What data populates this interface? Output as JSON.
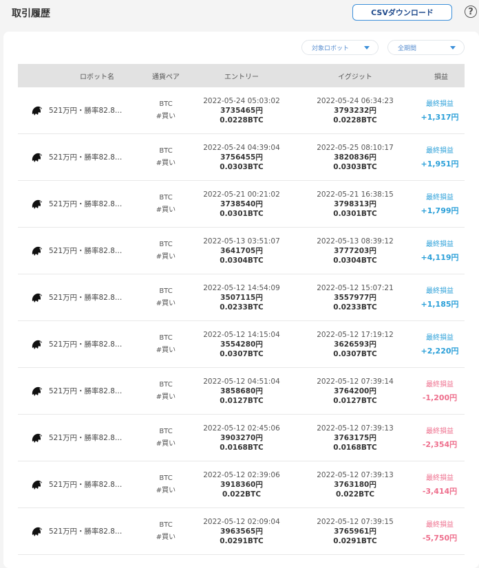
{
  "header": {
    "title": "取引履歴",
    "csv_button": "CSVダウンロード",
    "help_icon": "?"
  },
  "filters": {
    "robot": "対象ロボット",
    "period": "全期間"
  },
  "columns": {
    "robot": "ロボット名",
    "pair": "通貨ペア",
    "entry": "エントリー",
    "exit": "イグジット",
    "pnl": "損益"
  },
  "colors": {
    "profit": "#2a9fd8",
    "loss": "#ee6e8c",
    "accent": "#3b8fd9"
  },
  "rows": [
    {
      "robot": "521万円・勝率82.8…",
      "pair": "BTC",
      "side": "#買い",
      "entry_time": "2022-05-24 05:03:02",
      "entry_price": "3735465円",
      "entry_qty": "0.0228BTC",
      "exit_time": "2022-05-24 06:34:23",
      "exit_price": "3793232円",
      "exit_qty": "0.0228BTC",
      "pnl_label": "最終損益",
      "pnl": "+1,317円",
      "sign": "pos"
    },
    {
      "robot": "521万円・勝率82.8…",
      "pair": "BTC",
      "side": "#買い",
      "entry_time": "2022-05-24 04:39:04",
      "entry_price": "3756455円",
      "entry_qty": "0.0303BTC",
      "exit_time": "2022-05-25 08:10:17",
      "exit_price": "3820836円",
      "exit_qty": "0.0303BTC",
      "pnl_label": "最終損益",
      "pnl": "+1,951円",
      "sign": "pos"
    },
    {
      "robot": "521万円・勝率82.8…",
      "pair": "BTC",
      "side": "#買い",
      "entry_time": "2022-05-21 00:21:02",
      "entry_price": "3738540円",
      "entry_qty": "0.0301BTC",
      "exit_time": "2022-05-21 16:38:15",
      "exit_price": "3798313円",
      "exit_qty": "0.0301BTC",
      "pnl_label": "最終損益",
      "pnl": "+1,799円",
      "sign": "pos"
    },
    {
      "robot": "521万円・勝率82.8…",
      "pair": "BTC",
      "side": "#買い",
      "entry_time": "2022-05-13 03:51:07",
      "entry_price": "3641705円",
      "entry_qty": "0.0304BTC",
      "exit_time": "2022-05-13 08:39:12",
      "exit_price": "3777203円",
      "exit_qty": "0.0304BTC",
      "pnl_label": "最終損益",
      "pnl": "+4,119円",
      "sign": "pos"
    },
    {
      "robot": "521万円・勝率82.8…",
      "pair": "BTC",
      "side": "#買い",
      "entry_time": "2022-05-12 14:54:09",
      "entry_price": "3507115円",
      "entry_qty": "0.0233BTC",
      "exit_time": "2022-05-12 15:07:21",
      "exit_price": "3557977円",
      "exit_qty": "0.0233BTC",
      "pnl_label": "最終損益",
      "pnl": "+1,185円",
      "sign": "pos"
    },
    {
      "robot": "521万円・勝率82.8…",
      "pair": "BTC",
      "side": "#買い",
      "entry_time": "2022-05-12 14:15:04",
      "entry_price": "3554280円",
      "entry_qty": "0.0307BTC",
      "exit_time": "2022-05-12 17:19:12",
      "exit_price": "3626593円",
      "exit_qty": "0.0307BTC",
      "pnl_label": "最終損益",
      "pnl": "+2,220円",
      "sign": "pos"
    },
    {
      "robot": "521万円・勝率82.8…",
      "pair": "BTC",
      "side": "#買い",
      "entry_time": "2022-05-12 04:51:04",
      "entry_price": "3858680円",
      "entry_qty": "0.0127BTC",
      "exit_time": "2022-05-12 07:39:14",
      "exit_price": "3764200円",
      "exit_qty": "0.0127BTC",
      "pnl_label": "最終損益",
      "pnl": "-1,200円",
      "sign": "neg"
    },
    {
      "robot": "521万円・勝率82.8…",
      "pair": "BTC",
      "side": "#買い",
      "entry_time": "2022-05-12 02:45:06",
      "entry_price": "3903270円",
      "entry_qty": "0.0168BTC",
      "exit_time": "2022-05-12 07:39:13",
      "exit_price": "3763175円",
      "exit_qty": "0.0168BTC",
      "pnl_label": "最終損益",
      "pnl": "-2,354円",
      "sign": "neg"
    },
    {
      "robot": "521万円・勝率82.8…",
      "pair": "BTC",
      "side": "#買い",
      "entry_time": "2022-05-12 02:39:06",
      "entry_price": "3918360円",
      "entry_qty": "0.022BTC",
      "exit_time": "2022-05-12 07:39:13",
      "exit_price": "3763180円",
      "exit_qty": "0.022BTC",
      "pnl_label": "最終損益",
      "pnl": "-3,414円",
      "sign": "neg"
    },
    {
      "robot": "521万円・勝率82.8…",
      "pair": "BTC",
      "side": "#買い",
      "entry_time": "2022-05-12 02:09:04",
      "entry_price": "3963565円",
      "entry_qty": "0.0291BTC",
      "exit_time": "2022-05-12 07:39:15",
      "exit_price": "3765961円",
      "exit_qty": "0.0291BTC",
      "pnl_label": "最終損益",
      "pnl": "-5,750円",
      "sign": "neg"
    }
  ]
}
